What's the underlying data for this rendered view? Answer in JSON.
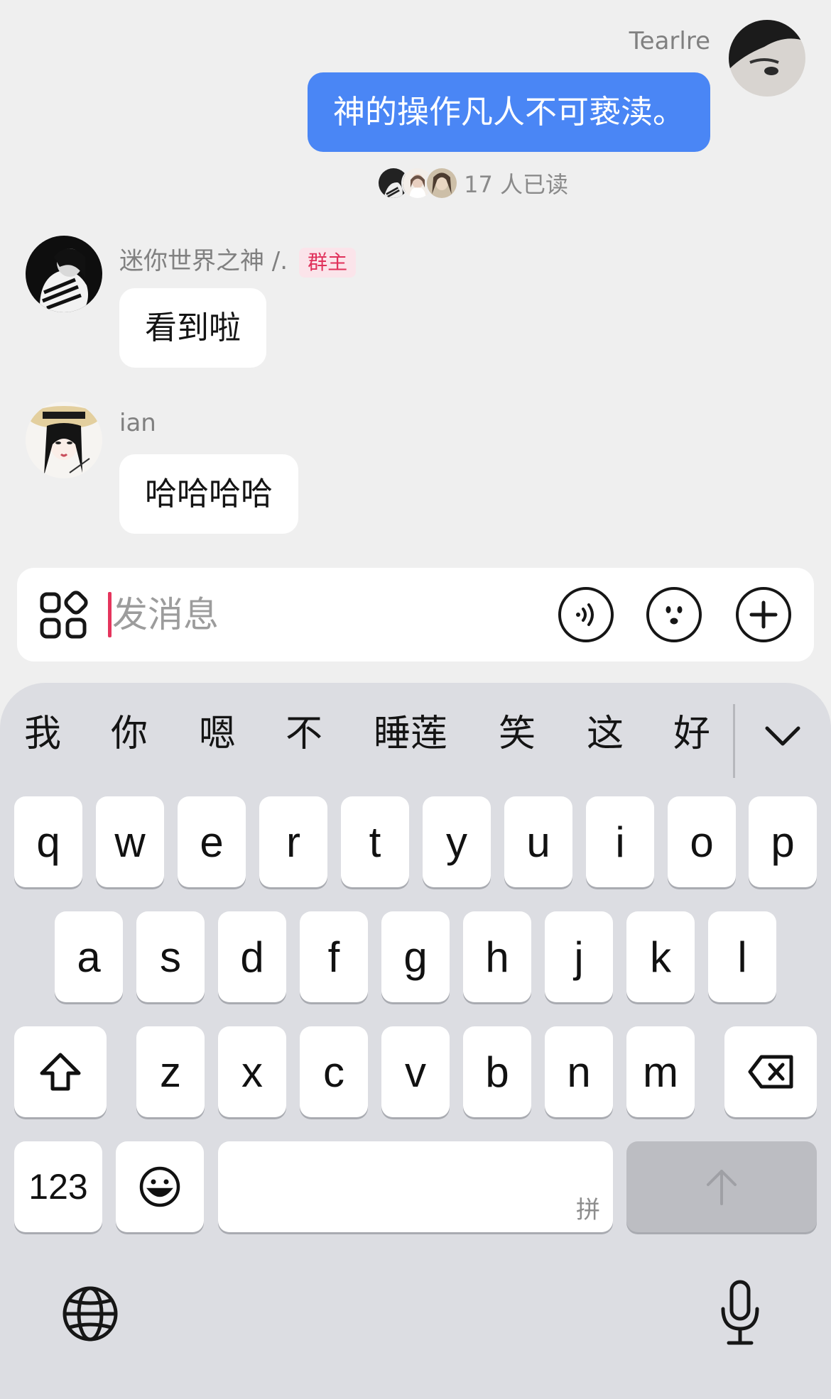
{
  "chat": {
    "messages": [
      {
        "sender": "Tearlre",
        "text": "神的操作凡人不可亵渎。",
        "mine": true,
        "read": "17 人已读"
      },
      {
        "sender": "迷你世界之神 /.",
        "badge": "群主",
        "text": "看到啦",
        "mine": false
      },
      {
        "sender": "ian",
        "text": "哈哈哈哈",
        "mine": false
      }
    ]
  },
  "input": {
    "placeholder": "发消息",
    "value": "",
    "icons": [
      "apps-icon",
      "voice-icon",
      "emoji-icon",
      "plus-icon"
    ]
  },
  "keyboard": {
    "candidates": [
      "我",
      "你",
      "嗯",
      "不",
      "睡莲",
      "笑",
      "这",
      "好"
    ],
    "row1": [
      "q",
      "w",
      "e",
      "r",
      "t",
      "y",
      "u",
      "i",
      "o",
      "p"
    ],
    "row2": [
      "a",
      "s",
      "d",
      "f",
      "g",
      "h",
      "j",
      "k",
      "l"
    ],
    "row3": [
      "z",
      "x",
      "c",
      "v",
      "b",
      "n",
      "m"
    ],
    "numbers_label": "123",
    "space_hint": "拼",
    "colors": {
      "background": "#dcdde2",
      "key": "#ffffff",
      "send_key": "#bcbdc2"
    }
  },
  "colors": {
    "accent_bubble": "#4a86f5",
    "owner_badge": "#e0315b",
    "caret": "#e5355d"
  }
}
